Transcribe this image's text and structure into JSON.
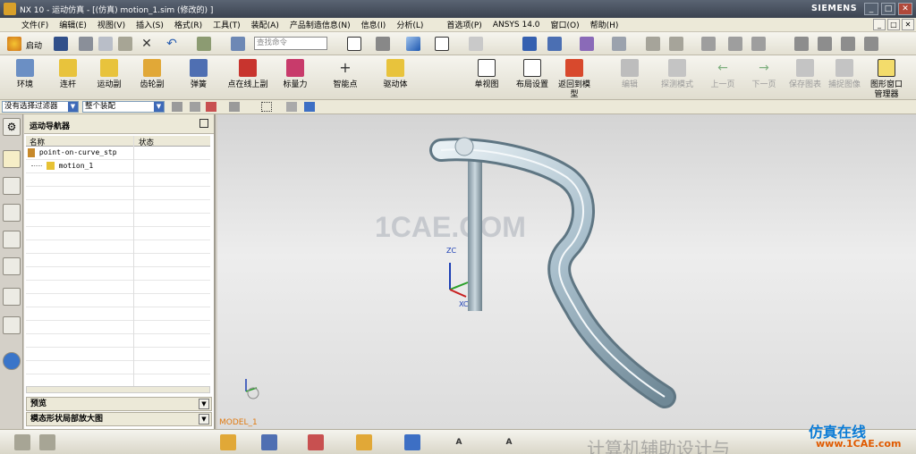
{
  "window": {
    "title": "NX 10 - 运动仿真 - [(仿真) motion_1.sim (修改的) ]",
    "brand": "SIEMENS",
    "controls": [
      "_",
      "□",
      "✕"
    ]
  },
  "menu": [
    "文件(F)",
    "编辑(E)",
    "视图(V)",
    "插入(S)",
    "格式(R)",
    "工具(T)",
    "装配(A)",
    "产品制造信息(N)",
    "信息(I)",
    "分析(L)",
    "首选项(P)",
    "ANSYS 14.0",
    "窗口(O)",
    "帮助(H)"
  ],
  "toolbar_top": {
    "start_label": "启动",
    "search_placeholder": "查找命令"
  },
  "toolbar_main": {
    "items": [
      "环境",
      "连杆",
      "运动副",
      "齿轮副",
      "弹簧",
      "点在线上副",
      "标量力",
      "智能点",
      "驱动体"
    ],
    "right_items": [
      "单视图",
      "布局设置",
      "返回到模型"
    ],
    "disabled_items": [
      "编辑",
      "探测模式",
      "上一页",
      "下一页",
      "保存图表",
      "捕捉图像"
    ],
    "last_item": "图形窗口管理器"
  },
  "selection_bar": {
    "filter": "没有选择过滤器",
    "scope": "整个装配"
  },
  "navigator": {
    "title": "运动导航器",
    "col_name": "名称",
    "col_status": "状态",
    "rows": [
      {
        "name": "point-on-curve_stp",
        "status": ""
      },
      {
        "name": "motion_1",
        "status": ""
      }
    ],
    "panel_preview": "预览",
    "panel_dependencies": "模态形状局部放大图"
  },
  "viewport": {
    "watermark": "1CAE.COM",
    "label": "MODEL_1",
    "axis_z": "ZC",
    "axis_x": "XC"
  },
  "footer_watermarks": {
    "wechat": "计算机辅助设计与",
    "site_name": "仿真在线",
    "site_url": "www.1CAE.com"
  },
  "colors": {
    "titlebar": "#444c58",
    "viewport_bg": "#e2e2e2",
    "tube": "#b8ccd6",
    "model_label": "#e07a10"
  }
}
